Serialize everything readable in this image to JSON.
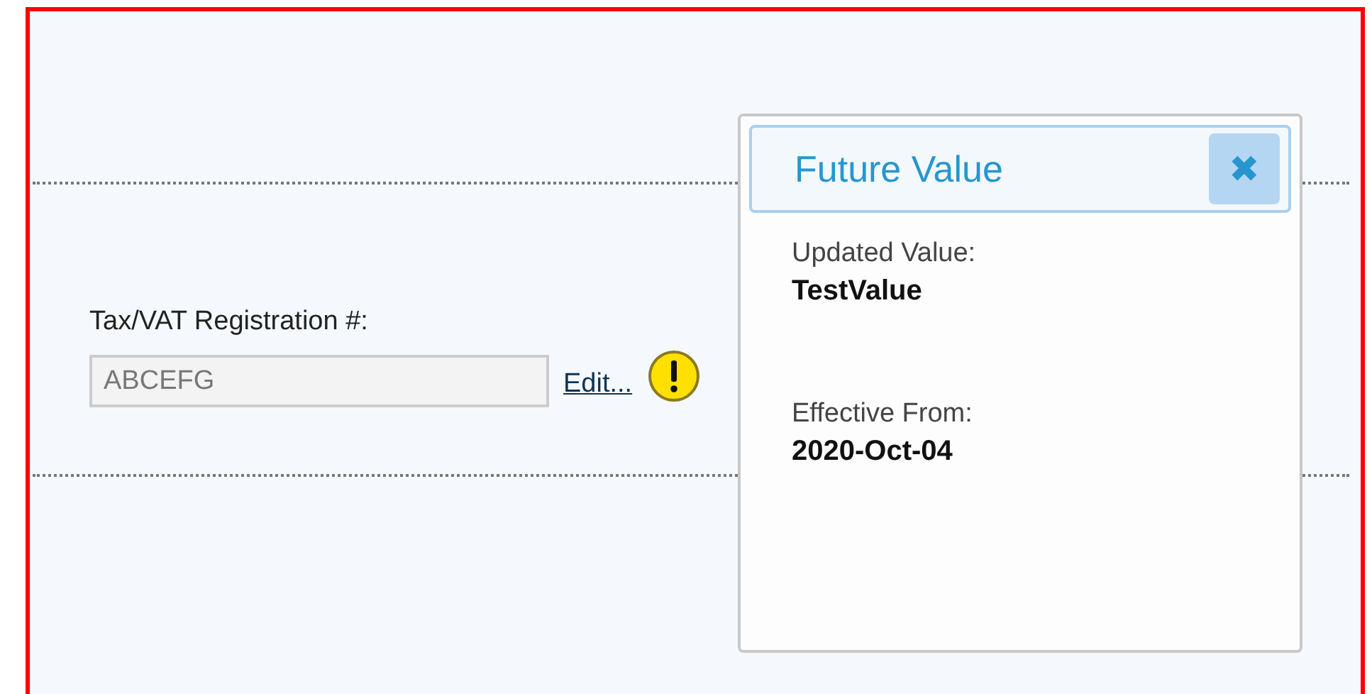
{
  "field": {
    "label": "Tax/VAT Registration #:",
    "value": "ABCEFG",
    "disabled": true,
    "link": "Edit...",
    "warning": true
  },
  "popup": {
    "title": "Future Value",
    "close": "✖",
    "entries": [
      {
        "label": "Updated Value:",
        "value": "TestValue"
      },
      {
        "label": "Effective From:",
        "value": "2020-Oct-04"
      }
    ]
  }
}
